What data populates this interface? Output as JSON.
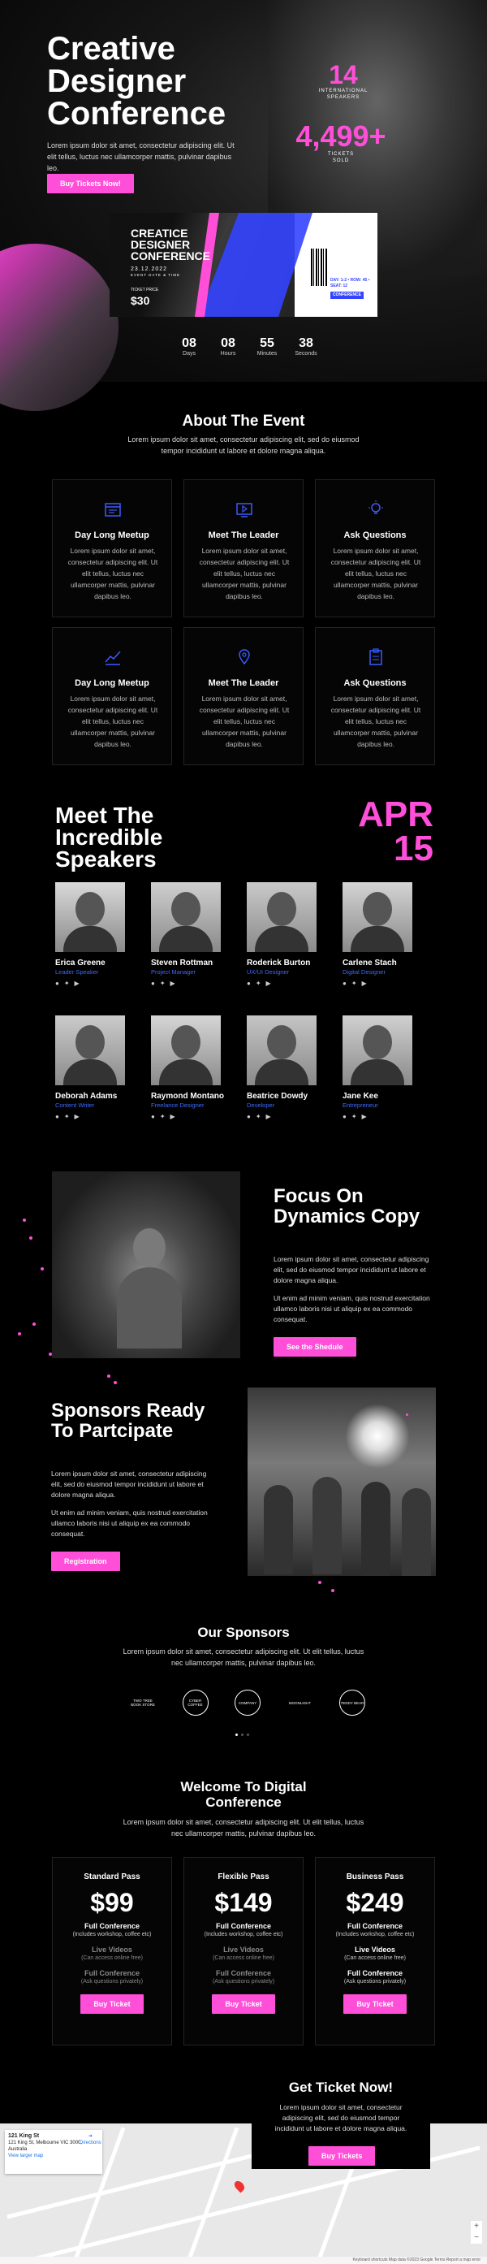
{
  "hero": {
    "title": "Creative Designer Conference",
    "text": "Lorem ipsum dolor sit amet, consectetur adipiscing elit. Ut elit tellus, luctus nec ullamcorper mattis, pulvinar dapibus leo.",
    "button": "Buy Tickets Now!",
    "stat1_value": "14",
    "stat1_label_line1": "INTERNATIONAL",
    "stat1_label_line2": "SPEAKERS",
    "stat2_value": "4,499+",
    "stat2_label_line1": "TICKETS",
    "stat2_label_line2": "SOLD"
  },
  "ticket": {
    "title": "CREATICE DESIGNER CONFERENCE",
    "date": "23.12.2022",
    "date_sub": "EVENT DATE & TIME",
    "price_label": "TICKET PRICE",
    "price": "$30",
    "side_text": "DAY: 1-2  •  ROW: 45  •  SEAT: 12",
    "side_button": "CONFERENCE"
  },
  "countdown": [
    {
      "value": "08",
      "label": "Days"
    },
    {
      "value": "08",
      "label": "Hours"
    },
    {
      "value": "55",
      "label": "Minutes"
    },
    {
      "value": "38",
      "label": "Seconds"
    }
  ],
  "about": {
    "title": "About The Event",
    "text": "Lorem ipsum dolor sit amet, consectetur adipiscing elit, sed do eiusmod tempor incididunt ut labore et dolore magna aliqua.",
    "cards": [
      {
        "icon": "calendar-icon",
        "title": "Day Long Meetup",
        "text": "Lorem ipsum dolor sit amet, consectetur adipiscing elit. Ut elit tellus, luctus nec ullamcorper mattis, pulvinar dapibus leo."
      },
      {
        "icon": "video-icon",
        "title": "Meet The Leader",
        "text": "Lorem ipsum dolor sit amet, consectetur adipiscing elit. Ut elit tellus, luctus nec ullamcorper mattis, pulvinar dapibus leo."
      },
      {
        "icon": "lightbulb-icon",
        "title": "Ask Questions",
        "text": "Lorem ipsum dolor sit amet, consectetur adipiscing elit. Ut elit tellus, luctus nec ullamcorper mattis, pulvinar dapibus leo."
      },
      {
        "icon": "chart-icon",
        "title": "Day Long Meetup",
        "text": "Lorem ipsum dolor sit amet, consectetur adipiscing elit. Ut elit tellus, luctus nec ullamcorper mattis, pulvinar dapibus leo."
      },
      {
        "icon": "location-pin-icon",
        "title": "Meet The Leader",
        "text": "Lorem ipsum dolor sit amet, consectetur adipiscing elit. Ut elit tellus, luctus nec ullamcorper mattis, pulvinar dapibus leo."
      },
      {
        "icon": "clipboard-icon",
        "title": "Ask Questions",
        "text": "Lorem ipsum dolor sit amet, consectetur adipiscing elit. Ut elit tellus, luctus nec ullamcorper mattis, pulvinar dapibus leo."
      }
    ]
  },
  "speakers": {
    "title": "Meet The Incredible Speakers",
    "month": "APR",
    "day": "15",
    "list": [
      {
        "name": "Erica Greene",
        "role": "Leader Speaker"
      },
      {
        "name": "Steven Rottman",
        "role": "Project Manager"
      },
      {
        "name": "Roderick Burton",
        "role": "UX/UI Designer"
      },
      {
        "name": "Carlene Stach",
        "role": "Digital Designer"
      },
      {
        "name": "Deborah Adams",
        "role": "Content Writer"
      },
      {
        "name": "Raymond Montano",
        "role": "Freelance Designer"
      },
      {
        "name": "Beatrice Dowdy",
        "role": "Developer"
      },
      {
        "name": "Jane Kee",
        "role": "Entrepreneur"
      }
    ]
  },
  "focus": {
    "title": "Focus On Dynamics Copy",
    "text1": "Lorem ipsum dolor sit amet, consectetur adipiscing elit, sed do eiusmod tempor incididunt ut labore et dolore magna aliqua.",
    "text2": "Ut enim ad minim veniam, quis nostrud exercitation ullamco laboris nisi ut aliquip ex ea commodo consequat.",
    "button": "See the Shedule"
  },
  "sponsors_block": {
    "title": "Sponsors Ready To Partcipate",
    "text1": "Lorem ipsum dolor sit amet, consectetur adipiscing elit, sed do eiusmod tempor incididunt ut labore et dolore magna aliqua.",
    "text2": "Ut enim ad minim veniam, quis nostrud exercitation ullamco laboris nisi ut aliquip ex ea commodo consequat.",
    "button": "Registration"
  },
  "our_sponsors": {
    "title": "Our Sponsors",
    "text": "Lorem ipsum dolor sit amet, consectetur adipiscing elit. Ut elit tellus, luctus nec ullamcorper mattis, pulvinar dapibus leo.",
    "logos": [
      {
        "icon": "book-logo-icon",
        "label": "TWO TREE\nBOOK STORE"
      },
      {
        "icon": "coffee-logo-icon",
        "label": "CYBER\nCOFFEE"
      },
      {
        "icon": "emblem-logo-icon",
        "label": "COMPANY"
      },
      {
        "icon": "moon-logo-icon",
        "label": "MOONLIGHT"
      },
      {
        "icon": "bear-logo-icon",
        "label": "TEDDY BEAR"
      }
    ]
  },
  "pricing": {
    "title": "Welcome To Digital Conference",
    "text": "Lorem ipsum dolor sit amet, consectetur adipiscing elit. Ut elit tellus, luctus nec ullamcorper mattis, pulvinar dapibus leo.",
    "plans": [
      {
        "name": "Standard Pass",
        "price": "$99",
        "f1": "Full Conference",
        "f1s": "(Includes workshop, coffee etc)",
        "f2": "Live Videos",
        "f2s": "(Can access online free)",
        "f3": "Full Conference",
        "f3s": "(Ask questions privately)",
        "button": "Buy Ticket"
      },
      {
        "name": "Flexible Pass",
        "price": "$149",
        "f1": "Full Conference",
        "f1s": "(Includes workshop, coffee etc)",
        "f2": "Live Videos",
        "f2s": "(Can access online free)",
        "f3": "Full Conference",
        "f3s": "(Ask questions privately)",
        "button": "Buy Ticket"
      },
      {
        "name": "Business Pass",
        "price": "$249",
        "f1": "Full Conference",
        "f1s": "(Includes workshop, coffee etc)",
        "f2": "Live Videos",
        "f2s": "(Can access online free)",
        "f3": "Full Conference",
        "f3s": "(Ask questions privately)",
        "button": "Buy Ticket"
      }
    ]
  },
  "get_ticket": {
    "title": "Get Ticket Now!",
    "text": "Lorem ipsum dolor sit amet, consectetur adipiscing elit, sed do eiusmod tempor incididunt ut labore et dolore magna aliqua.",
    "button": "Buy Tickets"
  },
  "map": {
    "place": "121 King St",
    "address": "121 King St, Melbourne VIC 3000, Australia",
    "link": "View larger map",
    "directions": "Directions",
    "footer": "Keyboard shortcuts  Map data ©2023 Google  Terms  Report a map error"
  },
  "colors": {
    "accent": "#ff4fd8",
    "blue": "#3344ff",
    "background": "#000000"
  }
}
